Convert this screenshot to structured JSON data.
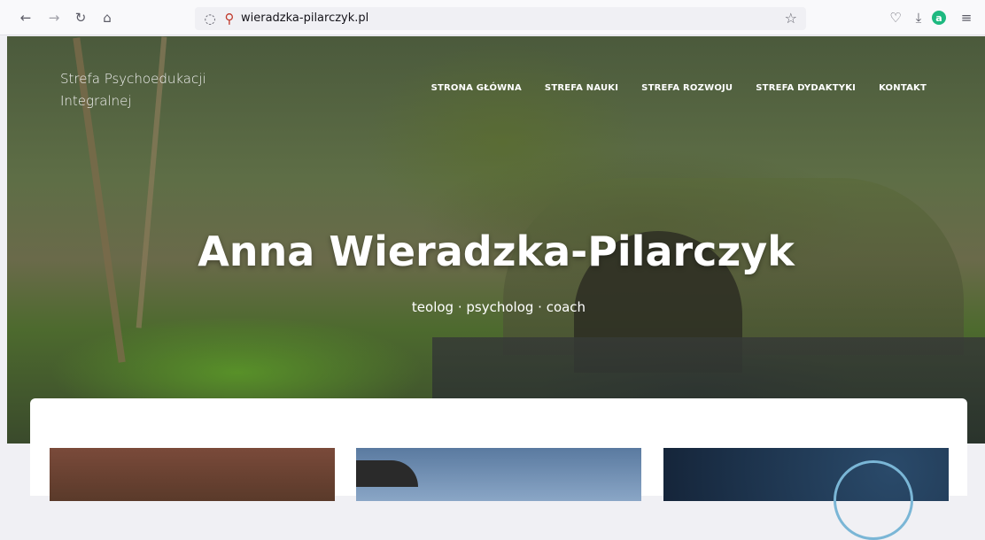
{
  "browser": {
    "url": "wieradzka-pilarczyk.pl",
    "icons": [
      "back-arrow-icon",
      "forward-arrow-icon",
      "reload-icon",
      "home-icon",
      "shield-icon",
      "permissions-icon",
      "bookmark-star-icon",
      "pocket-icon",
      "download-icon",
      "account-icon",
      "menu-icon"
    ]
  },
  "site": {
    "logo_line1": "Strefa Psychoedukacji",
    "logo_line2": "Integralnej",
    "nav": [
      "STRONA GŁÓWNA",
      "STREFA NAUKI",
      "STREFA ROZWOJU",
      "STREFA DYDAKTYKI",
      "KONTAKT"
    ]
  },
  "hero": {
    "title": "Anna Wieradzka-Pilarczyk",
    "subtitle": "teolog · psycholog · coach"
  }
}
